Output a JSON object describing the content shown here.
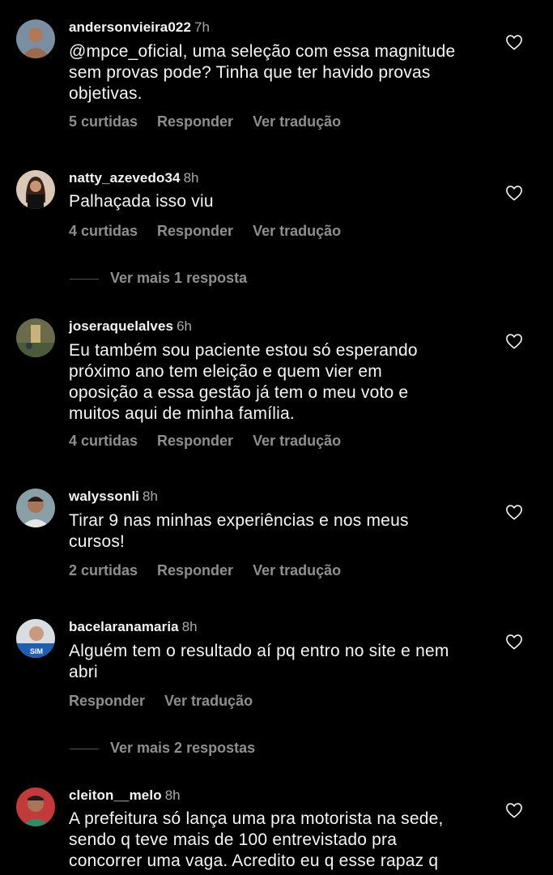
{
  "comments": [
    {
      "username": "andersonvieira022",
      "time": "7h",
      "lines": [
        "@mpce_oficial, uma seleção com essa magnitude",
        "sem provas pode? Tinha que ter havido provas",
        "objetivas."
      ],
      "likes": "5 curtidas",
      "reply": "Responder",
      "translate": "Ver tradução"
    },
    {
      "username": "natty_azevedo34",
      "time": "8h",
      "lines": [
        "Palhaçada isso viu"
      ],
      "likes": "4 curtidas",
      "reply": "Responder",
      "translate": "Ver tradução",
      "more_replies": "Ver mais 1 resposta"
    },
    {
      "username": "joseraquelalves",
      "time": "6h",
      "lines": [
        "Eu também sou paciente estou só esperando",
        "próximo ano tem eleição e quem vier em",
        "oposição a essa gestão já tem o meu voto e",
        "muitos aqui de minha família."
      ],
      "likes": "4 curtidas",
      "reply": "Responder",
      "translate": "Ver tradução"
    },
    {
      "username": "walyssonli",
      "time": "8h",
      "lines": [
        "Tirar 9 nas minhas experiências e nos meus",
        "cursos!"
      ],
      "likes": "2 curtidas",
      "reply": "Responder",
      "translate": "Ver tradução"
    },
    {
      "username": "bacelaranamaria",
      "time": "8h",
      "avatar_text": "SIM",
      "lines": [
        "Alguém tem o resultado aí pq entro no site e nem",
        "abri"
      ],
      "reply": "Responder",
      "translate": "Ver tradução",
      "more_replies": "Ver mais 2 respostas"
    },
    {
      "username": "cleiton__melo",
      "time": "8h",
      "lines": [
        "A prefeitura só lança uma pra motorista na sede,",
        "sendo q teve mais de 100 entrevistado pra",
        "concorrer uma vaga. Acredito eu q esse rapaz q"
      ]
    }
  ],
  "colors": {
    "background": "#000000",
    "text": "#f5f5f5",
    "muted": "#8e8e8e"
  }
}
